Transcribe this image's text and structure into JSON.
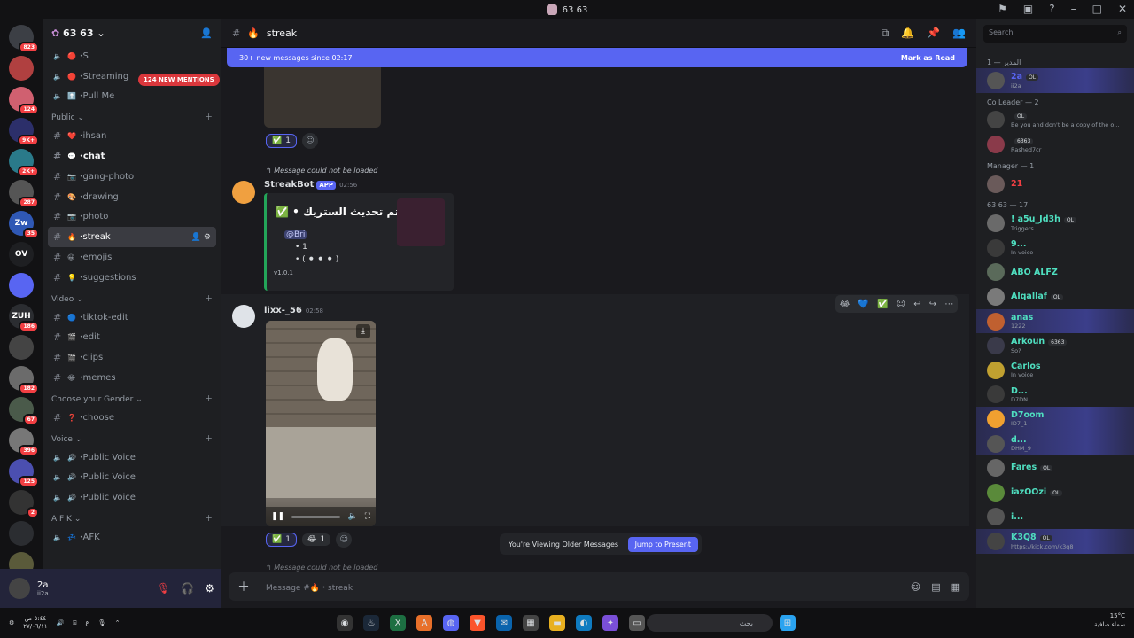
{
  "window": {
    "title": "63 63",
    "controls": [
      "flag",
      "monitor",
      "help",
      "minimize",
      "maximize",
      "close"
    ]
  },
  "rail": {
    "servers": [
      {
        "label": "",
        "badge": "823",
        "color": "#3c3f45"
      },
      {
        "label": "",
        "badge": "",
        "color": "#b04040"
      },
      {
        "label": "",
        "badge": "124",
        "color": "#d06070"
      },
      {
        "label": "",
        "badge": "9K+",
        "color": "#2c2f6a"
      },
      {
        "label": "",
        "badge": "2K+",
        "color": "#2a7a8a"
      },
      {
        "label": "",
        "badge": "287",
        "color": "#555"
      },
      {
        "label": "Zw",
        "badge": "35",
        "color": "#2f58b5"
      },
      {
        "label": "OV",
        "badge": "",
        "color": "#1e1f22"
      },
      {
        "label": "",
        "badge": "",
        "color": "#5865f2"
      },
      {
        "label": "ZUH",
        "badge": "186",
        "color": "#2b2d31"
      },
      {
        "label": "",
        "badge": "",
        "color": "#444"
      },
      {
        "label": "",
        "badge": "182",
        "color": "#6b6b6b"
      },
      {
        "label": "",
        "badge": "67",
        "color": "#4a5a4a"
      },
      {
        "label": "",
        "badge": "396",
        "color": "#777"
      },
      {
        "label": "",
        "badge": "125",
        "color": "#4b4fb0"
      },
      {
        "label": "",
        "badge": "2",
        "color": "#333"
      },
      {
        "label": "",
        "badge": "",
        "color": "#2b2d31"
      },
      {
        "label": "",
        "badge": "",
        "color": "#5a5a3a"
      },
      {
        "label": "5",
        "badge": "NEW",
        "color": "#121214"
      }
    ]
  },
  "guild": {
    "name": "63 63",
    "mention_pill": "124 NEW MENTIONS"
  },
  "channels_top": [
    {
      "icon": "🔴",
      "name": "S",
      "type": "voice"
    },
    {
      "icon": "🔴",
      "name": "Streaming",
      "type": "voice"
    },
    {
      "icon": "⬆️",
      "name": "Pull Me",
      "type": "voice"
    }
  ],
  "categories": [
    {
      "name": "Public",
      "channels": [
        {
          "icon": "❤️",
          "name": "ihsan",
          "type": "text",
          "state": ""
        },
        {
          "icon": "💬",
          "name": "chat",
          "type": "text",
          "state": "bold"
        },
        {
          "icon": "📷",
          "name": "gang-photo",
          "type": "text",
          "state": ""
        },
        {
          "icon": "🎨",
          "name": "drawing",
          "type": "text",
          "state": ""
        },
        {
          "icon": "📷",
          "name": "photo",
          "type": "text",
          "state": ""
        },
        {
          "icon": "🔥",
          "name": "streak",
          "type": "text",
          "state": "active"
        },
        {
          "icon": "😀",
          "name": "emojis",
          "type": "text",
          "state": ""
        },
        {
          "icon": "💡",
          "name": "suggestions",
          "type": "text",
          "state": ""
        }
      ]
    },
    {
      "name": "Video",
      "channels": [
        {
          "icon": "🔵",
          "name": "tiktok-edit",
          "type": "text",
          "state": ""
        },
        {
          "icon": "🎬",
          "name": "edit",
          "type": "text",
          "state": ""
        },
        {
          "icon": "🎬",
          "name": "clips",
          "type": "text",
          "state": ""
        },
        {
          "icon": "😂",
          "name": "memes",
          "type": "text",
          "state": ""
        }
      ]
    },
    {
      "name": "Choose your Gender",
      "channels": [
        {
          "icon": "❓",
          "name": "choose",
          "type": "text",
          "state": ""
        }
      ]
    },
    {
      "name": "Voice",
      "channels": [
        {
          "icon": "🔊",
          "name": "Public Voice",
          "type": "voice",
          "state": ""
        },
        {
          "icon": "🔊",
          "name": "Public Voice",
          "type": "voice",
          "state": ""
        },
        {
          "icon": "🔊",
          "name": "Public Voice",
          "type": "voice",
          "state": ""
        }
      ]
    },
    {
      "name": "A F K",
      "channels": [
        {
          "icon": "💤",
          "name": "AFK",
          "type": "voice",
          "state": ""
        }
      ]
    }
  ],
  "user": {
    "name": "2a",
    "status": "ii2a"
  },
  "header": {
    "channel": "streak",
    "icon": "🔥"
  },
  "new_messages": {
    "text": "30+ new messages since 02:17",
    "action": "Mark as Read"
  },
  "messages": {
    "first_reactions": [
      {
        "emoji": "✅",
        "count": "1"
      }
    ],
    "reply_1": "Message could not be loaded",
    "bot": {
      "name": "StreakBot",
      "tag": "APP",
      "time": "02:56",
      "embed_title": "تم تحديث الستريك • ✅",
      "mention": "@Bri",
      "line1": "• 1",
      "line2": "• ( ⚫ ⚫ ⚫ )",
      "footer": "v1.0.1"
    },
    "user_msg": {
      "name": "lixx-_56",
      "time": "02:58",
      "reactions": [
        {
          "emoji": "✅",
          "count": "1"
        },
        {
          "emoji": "😂",
          "count": "1"
        }
      ]
    },
    "reply_2": "Message could not be loaded"
  },
  "older_bar": {
    "text": "You're Viewing Older Messages",
    "action": "Jump to Present"
  },
  "composer": {
    "placeholder": "Message #🔥・streak"
  },
  "members_panel": {
    "search_placeholder": "Search",
    "groups": [
      {
        "title": "المدير — 1",
        "members": [
          {
            "name": "2a",
            "status": "ii2a",
            "tag": "OL",
            "color": "#5865f2",
            "highlight": true
          }
        ]
      },
      {
        "title": "Co Leader — 2",
        "members": [
          {
            "name": "",
            "status": "Be you and don't be a copy of the o...",
            "tag": "OL",
            "color": "#dbdee1",
            "highlight": false
          },
          {
            "name": "",
            "status": "Rashed7cr",
            "tag": "6363",
            "color": "#dbdee1",
            "highlight": false
          }
        ]
      },
      {
        "title": "Manager — 1",
        "members": [
          {
            "name": "21",
            "status": "",
            "tag": "",
            "color": "#f23f43",
            "highlight": false
          }
        ]
      },
      {
        "title": "63 63 — 17",
        "members": [
          {
            "name": "! a5u_Jd3h",
            "status": "Triggers.",
            "tag": "OL",
            "color": "#4fdfc0",
            "highlight": false
          },
          {
            "name": "9...",
            "status": "In voice",
            "tag": "",
            "color": "#4fdfc0",
            "highlight": false
          },
          {
            "name": "ABO ALFZ",
            "status": "",
            "tag": "",
            "color": "#4fdfc0",
            "highlight": false
          },
          {
            "name": "Alqallaf",
            "status": "",
            "tag": "OL",
            "color": "#4fdfc0",
            "highlight": false
          },
          {
            "name": "anas",
            "status": "1222",
            "tag": "",
            "color": "#4fdfc0",
            "highlight": true
          },
          {
            "name": "Arkoun",
            "status": "So?",
            "tag": "6363",
            "color": "#4fdfc0",
            "highlight": false
          },
          {
            "name": "Carlos",
            "status": "In voice",
            "tag": "",
            "color": "#4fdfc0",
            "highlight": false
          },
          {
            "name": "D...",
            "status": "D7DN",
            "tag": "",
            "color": "#4fdfc0",
            "highlight": false
          },
          {
            "name": "D7oom",
            "status": "ID7_1",
            "tag": "",
            "color": "#4fdfc0",
            "highlight": true
          },
          {
            "name": "d...",
            "status": "DHM_9",
            "tag": "",
            "color": "#4fdfc0",
            "highlight": true
          },
          {
            "name": "Fares",
            "status": "",
            "tag": "OL",
            "color": "#4fdfc0",
            "highlight": false
          },
          {
            "name": "iazOOzi",
            "status": "",
            "tag": "OL",
            "color": "#4fdfc0",
            "highlight": false
          },
          {
            "name": "i...",
            "status": "",
            "tag": "",
            "color": "#4fdfc0",
            "highlight": false
          },
          {
            "name": "K3Q8",
            "status": "https://kick.com/k3q8",
            "tag": "OL",
            "color": "#4fdfc0",
            "highlight": true
          }
        ]
      }
    ]
  },
  "taskbar": {
    "time": "٥:٤٤ ص",
    "date": "٢٧/٠٦/١١",
    "lang": "ع",
    "search": "بحث",
    "weather_temp": "15°C",
    "weather_text": "سماء صافية"
  }
}
